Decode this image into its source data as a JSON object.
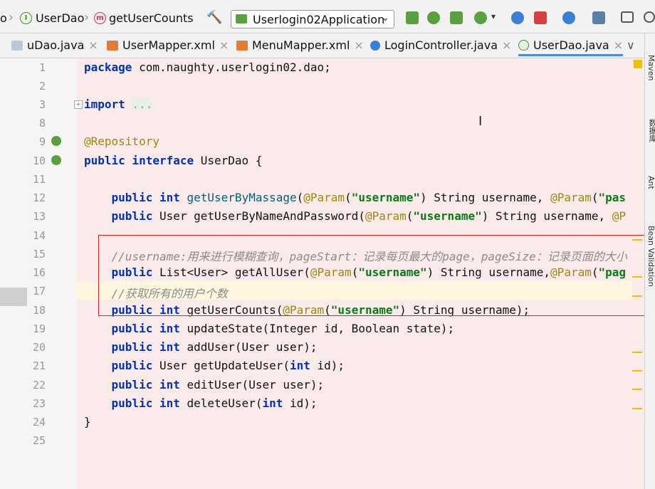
{
  "breadcrumb": {
    "items": [
      "o",
      "UserDao",
      "getUserCounts"
    ]
  },
  "toolbar": {
    "run_config": "Userlogin02Application"
  },
  "tabs": [
    {
      "label": "uDao.java"
    },
    {
      "label": "UserMapper.xml"
    },
    {
      "label": "MenuMapper.xml"
    },
    {
      "label": "LoginController.java"
    },
    {
      "label": "UserDao.java",
      "active": true
    }
  ],
  "tab_close": "×",
  "overflow": "∨",
  "editor": {
    "current_line": 17,
    "lines": [
      {
        "n": "1"
      },
      {
        "n": "2"
      },
      {
        "n": "3"
      },
      {
        "n": "8"
      },
      {
        "n": "9"
      },
      {
        "n": "10"
      },
      {
        "n": "11"
      },
      {
        "n": "12"
      },
      {
        "n": "13"
      },
      {
        "n": "14"
      },
      {
        "n": "15"
      },
      {
        "n": "16"
      },
      {
        "n": "17"
      },
      {
        "n": "18"
      },
      {
        "n": "19"
      },
      {
        "n": "20"
      },
      {
        "n": "21"
      },
      {
        "n": "22"
      },
      {
        "n": "23"
      },
      {
        "n": "24"
      },
      {
        "n": "25"
      }
    ]
  },
  "right_tool_windows": [
    "Maven",
    "数据库",
    "Ant",
    "Bean Validation"
  ],
  "colors": {
    "keyword": "#0033b3",
    "annotation": "#9e880d",
    "string": "#067d17",
    "comment": "#8c8c8c",
    "highlight_box": "#c82828",
    "active_tab_underline": "#4a8bd8"
  }
}
